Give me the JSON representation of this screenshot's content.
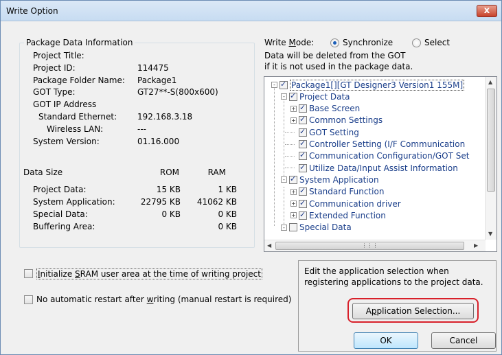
{
  "window": {
    "title": "Write Option",
    "close_glyph": "x"
  },
  "package_info": {
    "group_label": "Package Data Information",
    "rows": [
      {
        "label": "Project Title:",
        "value": ""
      },
      {
        "label": "Project ID:",
        "value": "114475"
      },
      {
        "label": "Package Folder Name:",
        "value": "Package1"
      },
      {
        "label": "GOT Type:",
        "value": "GT27**-S(800x600)"
      },
      {
        "label": "GOT IP Address",
        "value": ""
      },
      {
        "label": "Standard Ethernet:",
        "value": "192.168.3.18"
      },
      {
        "label": "Wireless LAN:",
        "value": "---"
      },
      {
        "label": "System Version:",
        "value": "01.16.000"
      }
    ],
    "data_size": {
      "label": "Data Size",
      "col_rom": "ROM",
      "col_ram": "RAM",
      "rows": [
        {
          "label": "Project Data:",
          "rom": "15 KB",
          "ram": "1 KB"
        },
        {
          "label": "System Application:",
          "rom": "22795 KB",
          "ram": "41062 KB"
        },
        {
          "label": "Special Data:",
          "rom": "0 KB",
          "ram": "0 KB"
        },
        {
          "label": "Buffering Area:",
          "rom": "",
          "ram": "0 KB"
        }
      ]
    }
  },
  "write_mode": {
    "label_pre": "Write ",
    "label_key": "M",
    "label_post": "ode:",
    "options": [
      {
        "label": "Synchronize",
        "selected": true
      },
      {
        "label": "Select",
        "selected": false
      }
    ],
    "note_line1": "Data will be deleted from the GOT",
    "note_line2": "if it is not used in the package data."
  },
  "tree": {
    "items": [
      {
        "label": "Package1[][GT Designer3 Version1 155M]",
        "checked": true,
        "expander": "-"
      },
      {
        "label": "Project Data",
        "checked": true,
        "expander": "-"
      },
      {
        "label": "Base Screen",
        "checked": true,
        "expander": "+"
      },
      {
        "label": "Common Settings",
        "checked": true,
        "expander": "+"
      },
      {
        "label": "GOT Setting",
        "checked": true,
        "expander": ""
      },
      {
        "label": "Controller Setting (I/F Communication",
        "checked": true,
        "expander": ""
      },
      {
        "label": "Communication Configuration/GOT Set",
        "checked": true,
        "expander": ""
      },
      {
        "label": "Utilize Data/Input Assist Information",
        "checked": true,
        "expander": ""
      },
      {
        "label": "System Application",
        "checked": true,
        "expander": "-"
      },
      {
        "label": "Standard Function",
        "checked": true,
        "expander": "+"
      },
      {
        "label": "Communication driver",
        "checked": true,
        "expander": "+"
      },
      {
        "label": "Extended Function",
        "checked": true,
        "expander": "+"
      },
      {
        "label": "Special Data",
        "checked": false,
        "expander": "-"
      }
    ]
  },
  "options": {
    "init_sram": {
      "pre": "",
      "key": "I",
      "post": "nitialize ",
      "key2": "S",
      "post2": "RAM user area at the time of writing project",
      "checked": false
    },
    "no_restart": {
      "pre": "No automatic restart after ",
      "key": "w",
      "post": "riting (manual restart is required)",
      "checked": false
    }
  },
  "app_selection": {
    "note_line1": "Edit the application selection when",
    "note_line2": "registering applications to the project data.",
    "button_pre": "A",
    "button_key": "p",
    "button_post": "plication Selection..."
  },
  "buttons": {
    "ok": "OK",
    "cancel": "Cancel"
  },
  "colors": {
    "highlight": "#d8202a",
    "tree_text": "#1a3e8a",
    "radio_dot": "#1c5fb8"
  }
}
